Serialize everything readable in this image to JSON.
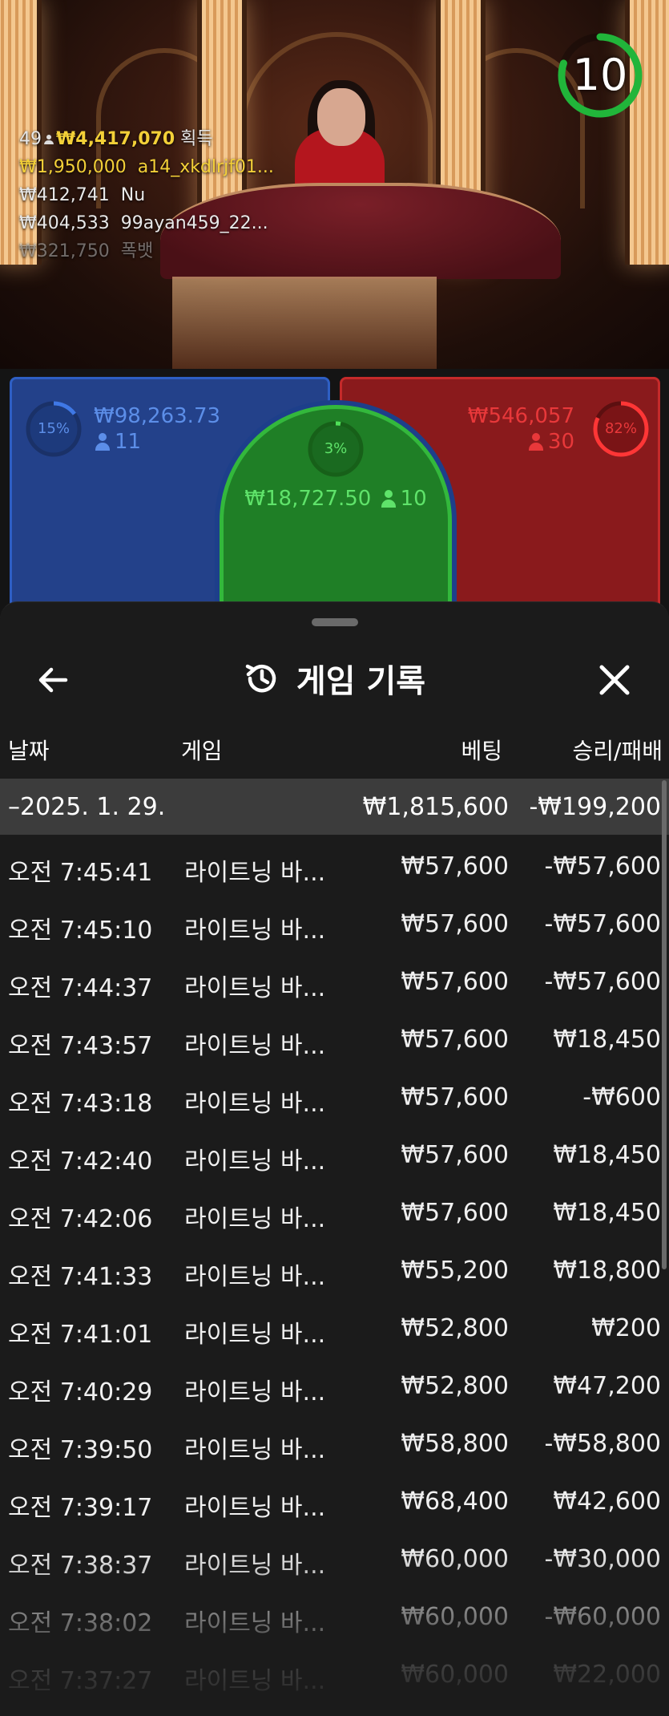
{
  "video": {
    "countdown": "10",
    "countdown_progress": 0.8,
    "winners_summary": {
      "count": "49",
      "total": "₩4,417,070",
      "suffix": "획득"
    },
    "top_winners": [
      {
        "amount": "₩1,950,000",
        "name": "a14_xkdlrjf01...",
        "highlight": true
      },
      {
        "amount": "₩412,741",
        "name": "Nu",
        "highlight": false
      },
      {
        "amount": "₩404,533",
        "name": "99ayan459_22...",
        "highlight": false
      },
      {
        "amount": "₩321,750",
        "name": "폭뱃",
        "highlight": false
      }
    ]
  },
  "bets": {
    "player": {
      "percent": "15%",
      "percent_value": 15,
      "amount": "₩98,263.73",
      "players": "11",
      "color": "#2e5fc4"
    },
    "tie": {
      "percent": "3%",
      "percent_value": 3,
      "amount": "₩18,727.50",
      "players": "10",
      "color": "#33b83c"
    },
    "banker": {
      "percent": "82%",
      "percent_value": 82,
      "amount": "₩546,057",
      "players": "30",
      "color": "#c42a2a"
    }
  },
  "history": {
    "title": "게임 기록",
    "columns": {
      "date": "날짜",
      "game": "게임",
      "bet": "베팅",
      "result": "승리/패배"
    },
    "day": {
      "label": "–2025. 1. 29.",
      "bet": "₩1,815,600",
      "result": "-₩199,200"
    },
    "rows": [
      {
        "time": "오전 7:45:41",
        "game": "라이트닝 바...",
        "bet": "₩57,600",
        "result": "-₩57,600"
      },
      {
        "time": "오전 7:45:10",
        "game": "라이트닝 바...",
        "bet": "₩57,600",
        "result": "-₩57,600"
      },
      {
        "time": "오전 7:44:37",
        "game": "라이트닝 바...",
        "bet": "₩57,600",
        "result": "-₩57,600"
      },
      {
        "time": "오전 7:43:57",
        "game": "라이트닝 바...",
        "bet": "₩57,600",
        "result": "₩18,450"
      },
      {
        "time": "오전 7:43:18",
        "game": "라이트닝 바...",
        "bet": "₩57,600",
        "result": "-₩600"
      },
      {
        "time": "오전 7:42:40",
        "game": "라이트닝 바...",
        "bet": "₩57,600",
        "result": "₩18,450"
      },
      {
        "time": "오전 7:42:06",
        "game": "라이트닝 바...",
        "bet": "₩57,600",
        "result": "₩18,450"
      },
      {
        "time": "오전 7:41:33",
        "game": "라이트닝 바...",
        "bet": "₩55,200",
        "result": "₩18,800"
      },
      {
        "time": "오전 7:41:01",
        "game": "라이트닝 바...",
        "bet": "₩52,800",
        "result": "₩200"
      },
      {
        "time": "오전 7:40:29",
        "game": "라이트닝 바...",
        "bet": "₩52,800",
        "result": "₩47,200"
      },
      {
        "time": "오전 7:39:50",
        "game": "라이트닝 바...",
        "bet": "₩58,800",
        "result": "-₩58,800"
      },
      {
        "time": "오전 7:39:17",
        "game": "라이트닝 바...",
        "bet": "₩68,400",
        "result": "₩42,600"
      },
      {
        "time": "오전 7:38:37",
        "game": "라이트닝 바...",
        "bet": "₩60,000",
        "result": "-₩30,000"
      },
      {
        "time": "오전 7:38:02",
        "game": "라이트닝 바...",
        "bet": "₩60,000",
        "result": "-₩60,000"
      },
      {
        "time": "오전 7:37:27",
        "game": "라이트닝 바...",
        "bet": "₩60,000",
        "result": "₩22,000"
      }
    ]
  },
  "icons": {
    "back": "arrow-left-icon",
    "history": "history-clock-icon",
    "close": "close-icon",
    "person": "person-icon"
  }
}
